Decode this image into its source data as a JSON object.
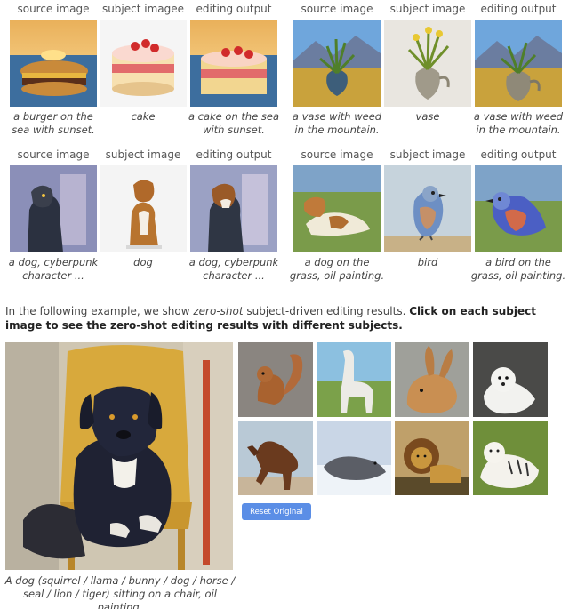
{
  "rows": [
    {
      "groups": [
        {
          "headers": [
            "source image",
            "subject imagee",
            "editing output"
          ],
          "captions": [
            "a burger on the sea with sunset.",
            "cake",
            "a cake on the sea with sunset."
          ]
        },
        {
          "headers": [
            "source image",
            "subject image",
            "editing output"
          ],
          "captions": [
            "a vase with weed in the mountain.",
            "vase",
            "a vase with weed in the mountain."
          ]
        }
      ]
    },
    {
      "groups": [
        {
          "headers": [
            "source image",
            "subject image",
            "editing output"
          ],
          "captions": [
            "a dog, cyberpunk character ...",
            "dog",
            "a dog, cyberpunk character ..."
          ]
        },
        {
          "headers": [
            "source image",
            "subject image",
            "editing output"
          ],
          "captions": [
            "a dog on the grass, oil painting.",
            "bird",
            "a bird on the grass, oil painting."
          ]
        }
      ]
    }
  ],
  "intro": {
    "prefix": "In the following example, we show ",
    "emphasis": "zero-shot",
    "middle": " subject-driven editing results. ",
    "bold": "Click on each subject image to see the zero-shot editing results with different subjects."
  },
  "main_caption": "A dog (squirrel / llama / bunny / dog / horse / seal / lion / tiger) sitting on a chair, oil painting.",
  "subjects": [
    "squirrel",
    "llama",
    "bunny",
    "dog",
    "horse",
    "seal",
    "lion",
    "tiger"
  ],
  "reset_label": "Reset Original"
}
